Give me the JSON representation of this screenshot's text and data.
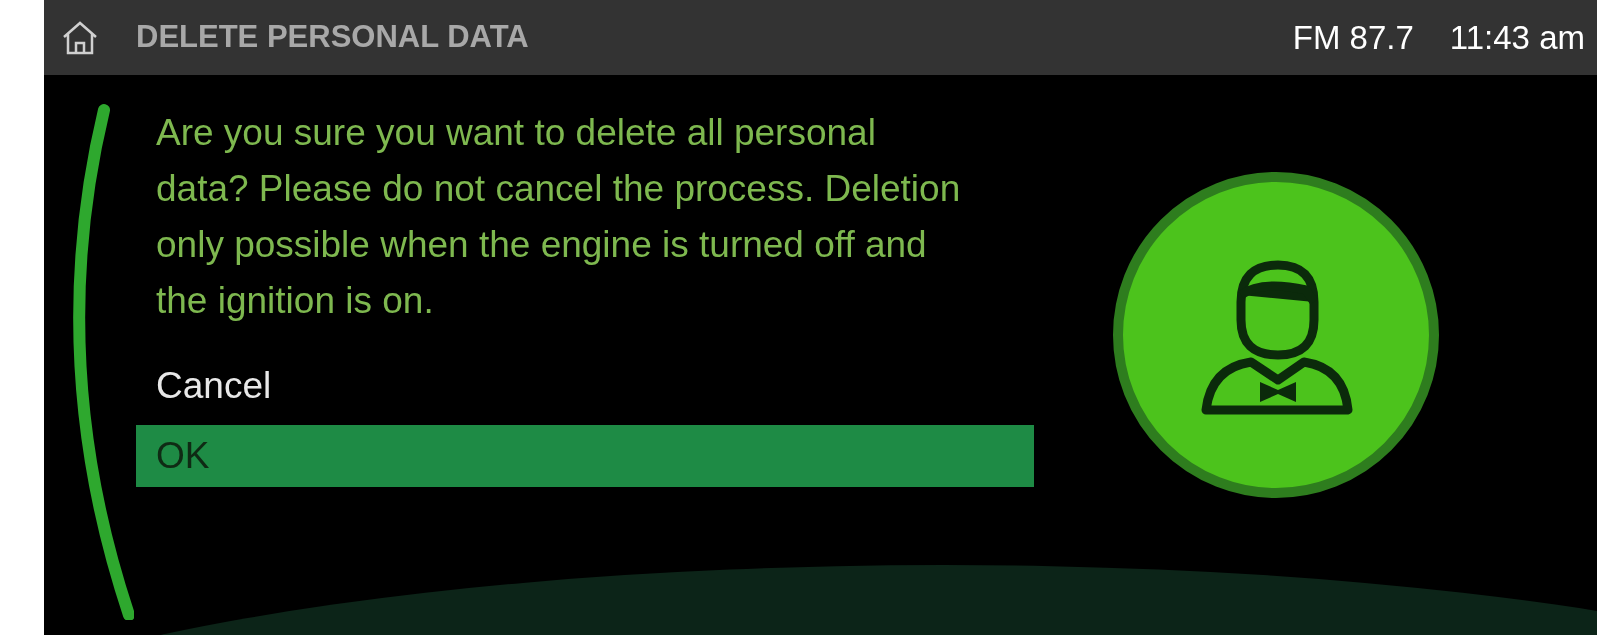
{
  "header": {
    "title": "DELETE PERSONAL DATA",
    "radio": "FM 87.7",
    "time": "11:43 am"
  },
  "message": "Are you sure you want to delete all personal data? Please do not cancel the process. Deletion only possible when the engine is turned off and the ignition is on.",
  "options": [
    {
      "label": "Cancel",
      "selected": false
    },
    {
      "label": "OK",
      "selected": true
    }
  ]
}
